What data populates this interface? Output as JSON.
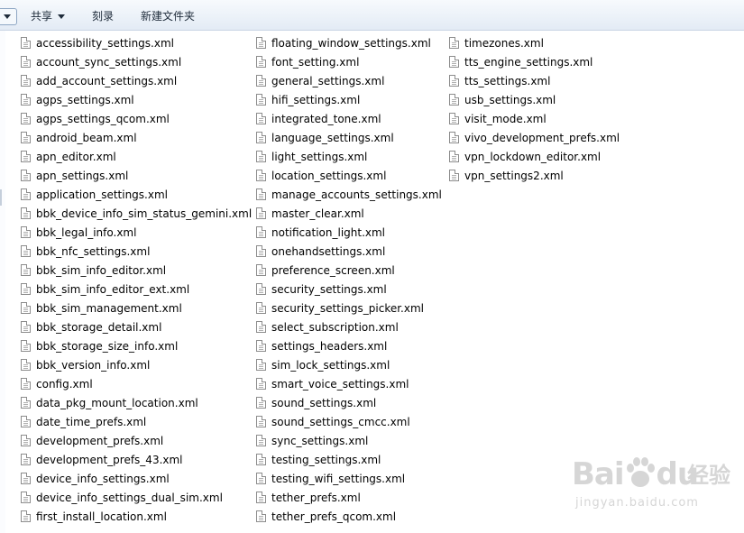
{
  "toolbar": {
    "share_label": "共享",
    "burn_label": "刻录",
    "new_folder_label": "新建文件夹"
  },
  "files": {
    "column1": [
      "accessibility_settings.xml",
      "account_sync_settings.xml",
      "add_account_settings.xml",
      "agps_settings.xml",
      "agps_settings_qcom.xml",
      "android_beam.xml",
      "apn_editor.xml",
      "apn_settings.xml",
      "application_settings.xml",
      "bbk_device_info_sim_status_gemini.xml",
      "bbk_legal_info.xml",
      "bbk_nfc_settings.xml",
      "bbk_sim_info_editor.xml",
      "bbk_sim_info_editor_ext.xml",
      "bbk_sim_management.xml",
      "bbk_storage_detail.xml",
      "bbk_storage_size_info.xml",
      "bbk_version_info.xml",
      "config.xml",
      "data_pkg_mount_location.xml",
      "date_time_prefs.xml",
      "development_prefs.xml",
      "development_prefs_43.xml",
      "device_info_settings.xml",
      "device_info_settings_dual_sim.xml",
      "first_install_location.xml"
    ],
    "column2": [
      "floating_window_settings.xml",
      "font_setting.xml",
      "general_settings.xml",
      "hifi_settings.xml",
      "integrated_tone.xml",
      "language_settings.xml",
      "light_settings.xml",
      "location_settings.xml",
      "manage_accounts_settings.xml",
      "master_clear.xml",
      "notification_light.xml",
      "onehandsettings.xml",
      "preference_screen.xml",
      "security_settings.xml",
      "security_settings_picker.xml",
      "select_subscription.xml",
      "settings_headers.xml",
      "sim_lock_settings.xml",
      "smart_voice_settings.xml",
      "sound_settings.xml",
      "sound_settings_cmcc.xml",
      "sync_settings.xml",
      "testing_settings.xml",
      "testing_wifi_settings.xml",
      "tether_prefs.xml",
      "tether_prefs_qcom.xml"
    ],
    "column3": [
      "timezones.xml",
      "tts_engine_settings.xml",
      "tts_settings.xml",
      "usb_settings.xml",
      "visit_mode.xml",
      "vivo_development_prefs.xml",
      "vpn_lockdown_editor.xml",
      "vpn_settings2.xml"
    ]
  },
  "icons": {
    "file": "xml-file-icon",
    "toolbar_dropdown": "chevron-down-icon"
  },
  "watermark": {
    "brand": "Bai",
    "brand_suffix": "du",
    "cn": "经验",
    "url": "jingyan.baidu.com"
  },
  "colors": {
    "toolbar_bg": "#e3ebf5",
    "toolbar_text": "#1e2b3a",
    "watermark": "#d6d6d6"
  }
}
